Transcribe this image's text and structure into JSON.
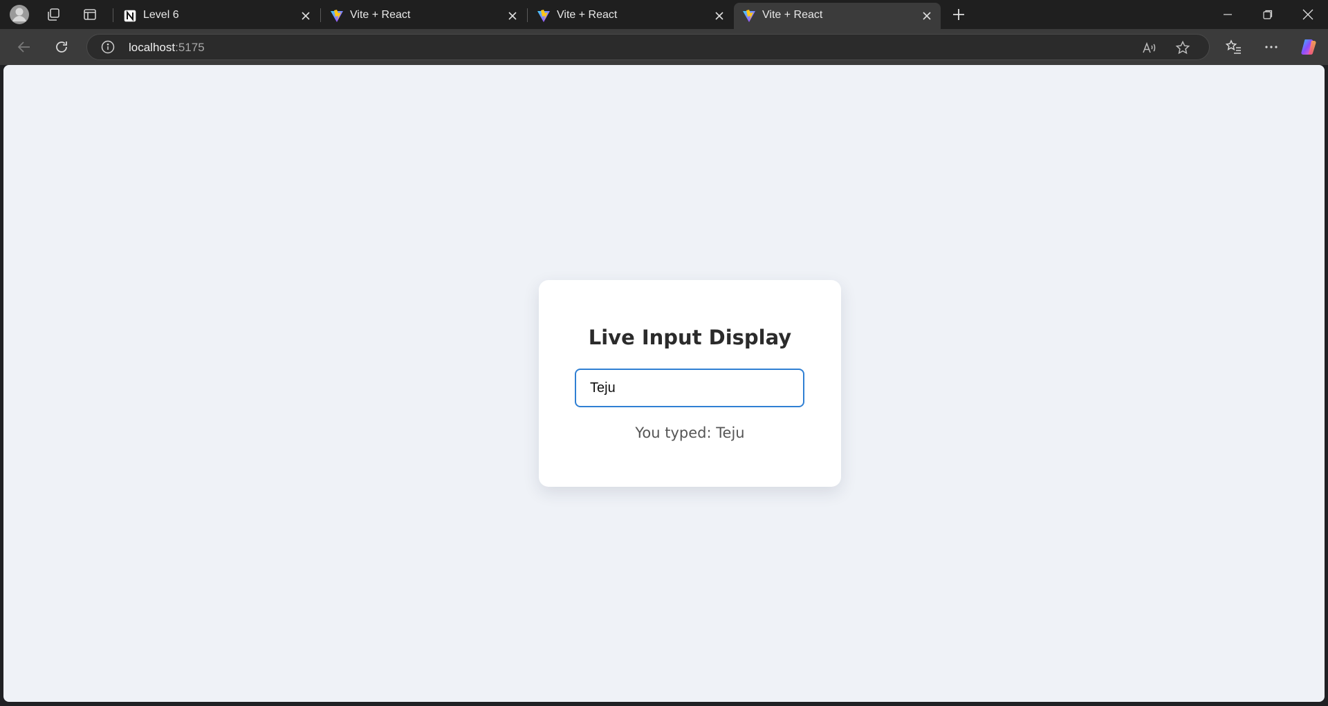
{
  "browser": {
    "tabs": [
      {
        "title": "Level 6",
        "favicon": "notion-icon",
        "active": false
      },
      {
        "title": "Vite + React",
        "favicon": "vite-icon",
        "active": false
      },
      {
        "title": "Vite + React",
        "favicon": "vite-icon",
        "active": false
      },
      {
        "title": "Vite + React",
        "favicon": "vite-icon",
        "active": true
      }
    ],
    "address": {
      "host": "localhost",
      "port": ":5175"
    }
  },
  "page": {
    "title": "Live Input Display",
    "input_value": "Teju",
    "output_prefix": "You typed: ",
    "output_value": "Teju"
  },
  "colors": {
    "input_focus_border": "#2f7fd3",
    "page_background": "#eff2f7"
  }
}
